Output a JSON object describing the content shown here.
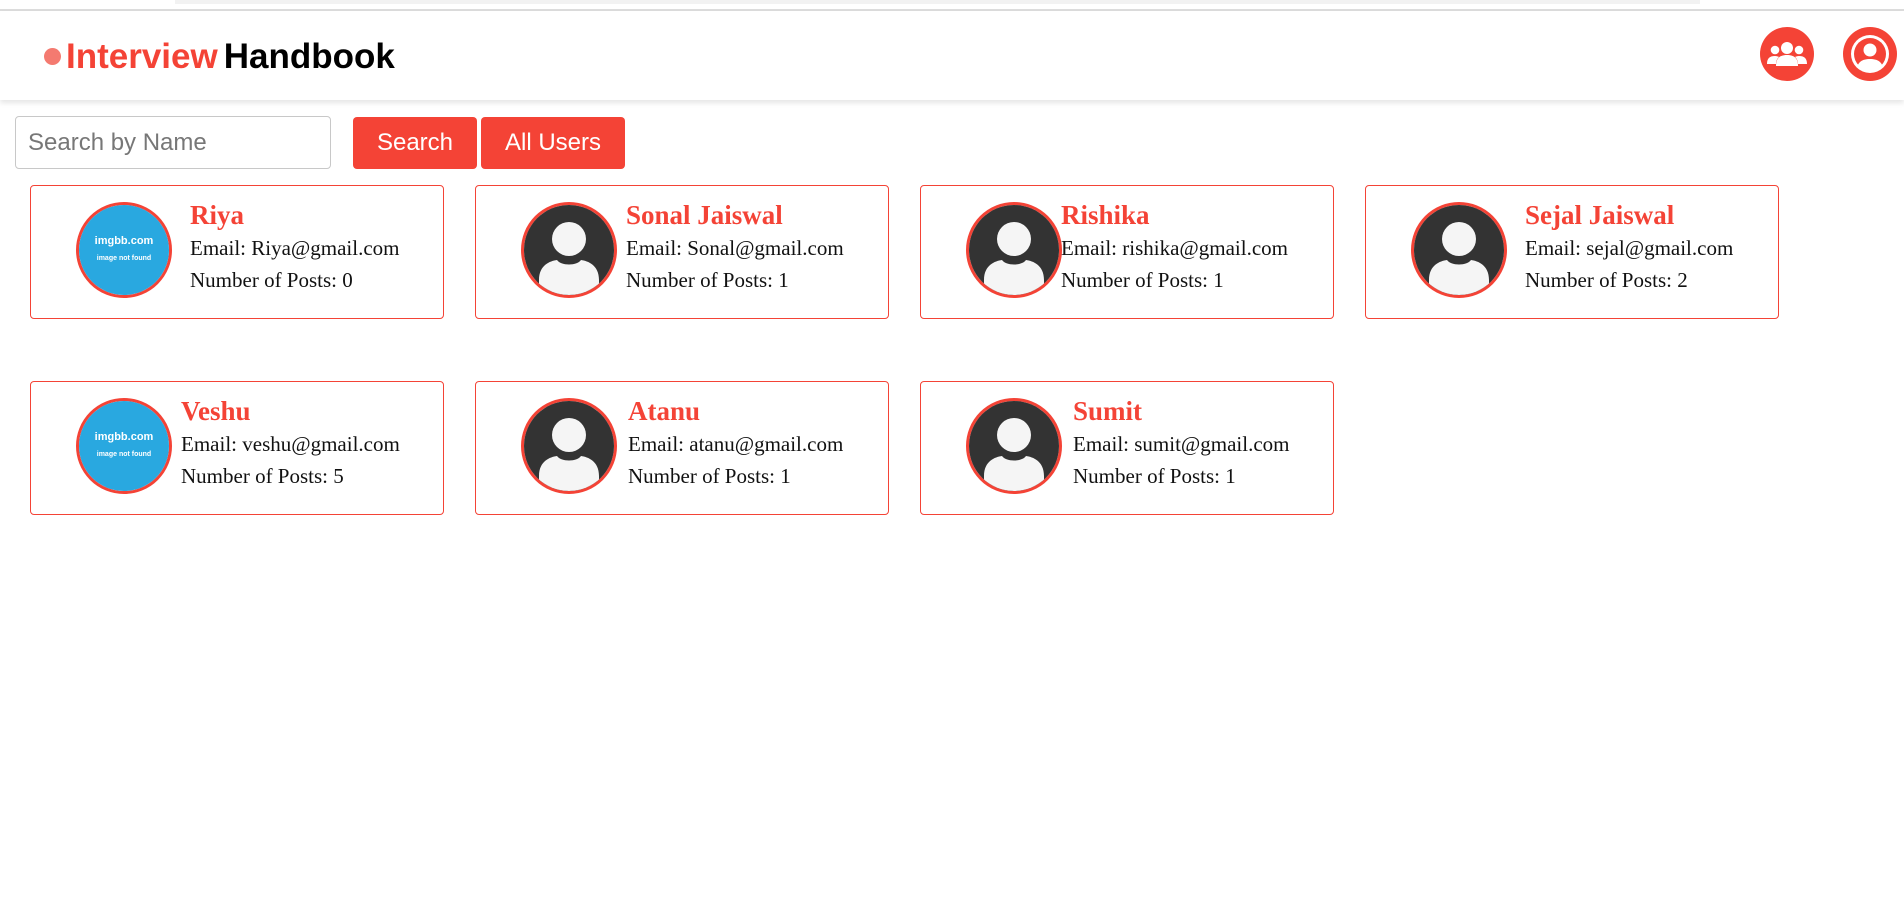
{
  "colors": {
    "accent": "#f44336",
    "logo_dot": "#f47a70",
    "default_avatar_bg": "#333333",
    "avatar_fill": "#f5f5f5",
    "imgbb_bg": "#29a8e0"
  },
  "header": {
    "logo_part1": "Interview",
    "logo_part2": "Handbook",
    "users_icon": "users-group-icon",
    "profile_icon": "user-circle-icon"
  },
  "search": {
    "placeholder": "Search by Name",
    "value": "",
    "search_label": "Search",
    "all_users_label": "All Users"
  },
  "labels": {
    "email_prefix": "Email: ",
    "posts_prefix": "Number of Posts: "
  },
  "placeholder_image": {
    "line1": "imgbb.com",
    "line2": "image not found"
  },
  "users": [
    {
      "name": "Riya",
      "email": "Riya@gmail.com",
      "posts": "0",
      "avatar": "imgbb-placeholder"
    },
    {
      "name": "Sonal Jaiswal",
      "email": "Sonal@gmail.com",
      "posts": "1",
      "avatar": "default-person"
    },
    {
      "name": "Rishika",
      "email": "rishika@gmail.com",
      "posts": "1",
      "avatar": "default-person"
    },
    {
      "name": "Sejal Jaiswal",
      "email": "sejal@gmail.com",
      "posts": "2",
      "avatar": "default-person"
    },
    {
      "name": "Veshu",
      "email": "veshu@gmail.com",
      "posts": "5",
      "avatar": "imgbb-placeholder"
    },
    {
      "name": "Atanu",
      "email": "atanu@gmail.com",
      "posts": "1",
      "avatar": "default-person"
    },
    {
      "name": "Sumit",
      "email": "sumit@gmail.com",
      "posts": "1",
      "avatar": "default-person"
    }
  ]
}
